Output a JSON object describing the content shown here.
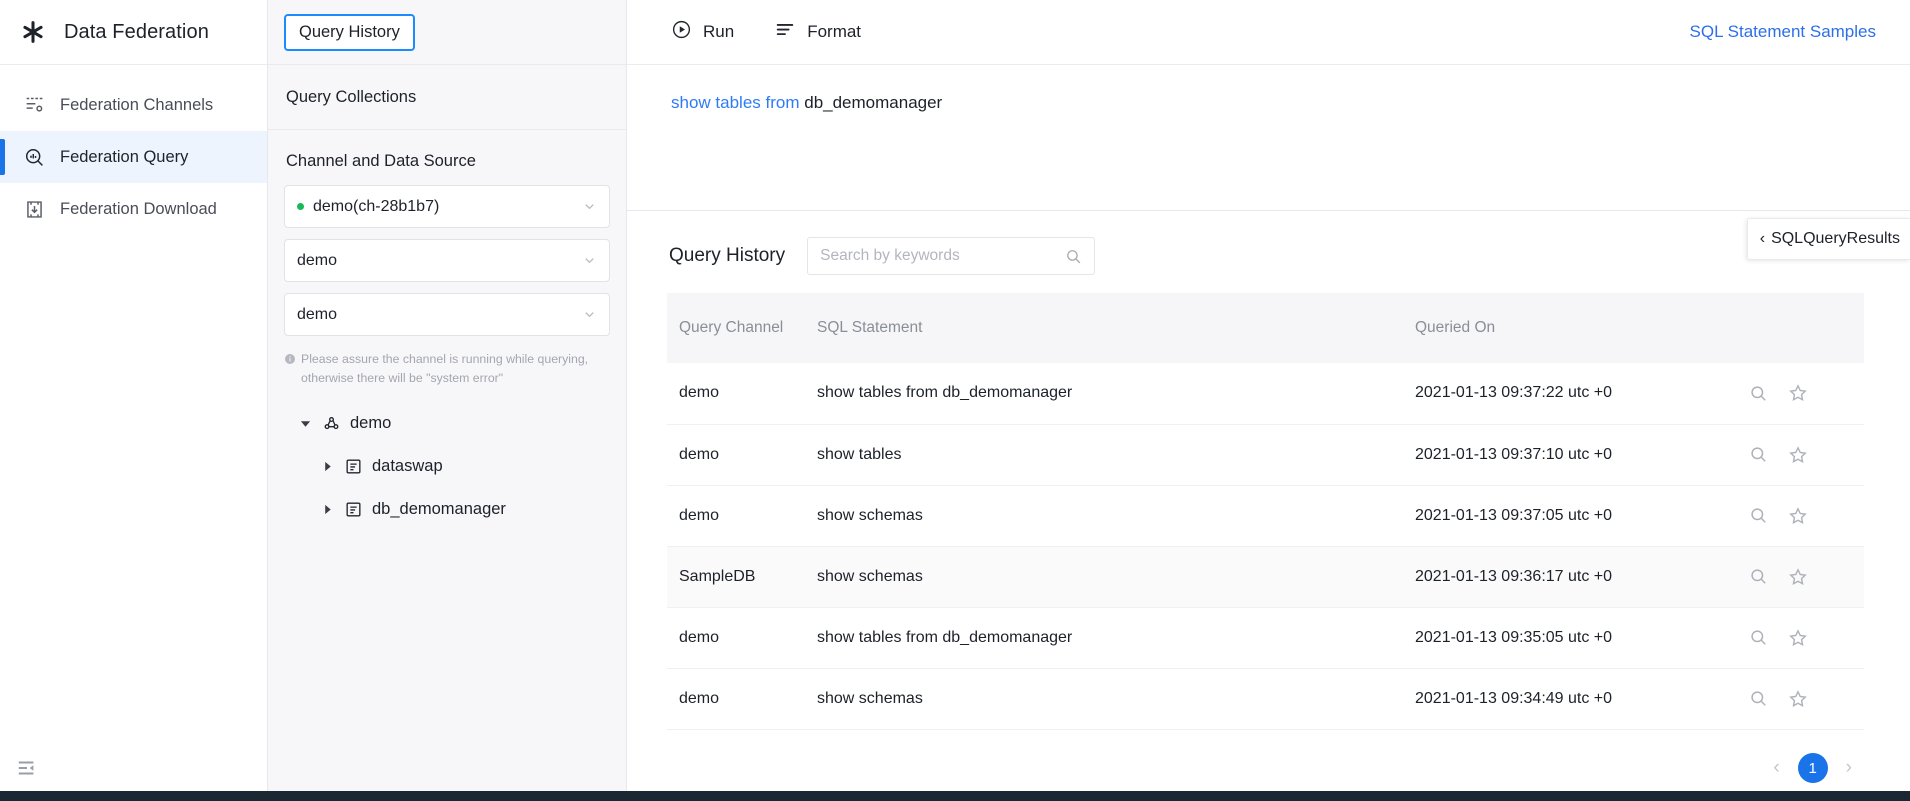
{
  "brand": {
    "title": "Data Federation",
    "logo_icon": "asterisk-logo-icon"
  },
  "sidebar": {
    "items": [
      {
        "label": "Federation Channels",
        "icon": "channels-icon",
        "active": false
      },
      {
        "label": "Federation Query",
        "icon": "query-search-icon",
        "active": true
      },
      {
        "label": "Federation Download",
        "icon": "download-box-icon",
        "active": false
      }
    ],
    "collapse_icon": "collapse-panel-icon"
  },
  "panel": {
    "tabs": [
      {
        "label": "Query History",
        "focused": true
      },
      {
        "label": "Query Collections",
        "focused": false
      }
    ],
    "section_title": "Channel and Data Source",
    "selects": [
      {
        "value": "demo(ch-28b1b7)",
        "status_dot": true,
        "dot_color": "#19b955"
      },
      {
        "value": "demo",
        "status_dot": false
      },
      {
        "value": "demo",
        "status_dot": false
      }
    ],
    "hint": "Please assure the channel is running while querying, otherwise there will be \"system error\"",
    "hint_icon": "info-circle-icon",
    "tree": [
      {
        "label": "demo",
        "icon": "catalog-icon",
        "expanded": true,
        "level": 0
      },
      {
        "label": "dataswap",
        "icon": "schema-icon",
        "expanded": false,
        "level": 1
      },
      {
        "label": "db_demomanager",
        "icon": "schema-icon",
        "expanded": false,
        "level": 1
      }
    ]
  },
  "toolbar": {
    "run_label": "Run",
    "run_icon": "play-circle-icon",
    "format_label": "Format",
    "format_icon": "format-lines-icon",
    "samples_link": "SQL Statement Samples"
  },
  "editor": {
    "keyword_part": "show tables from",
    "rest_part": "db_demomanager"
  },
  "results": {
    "title": "Query History",
    "search_placeholder": "Search by keywords",
    "search_value": "",
    "search_icon": "search-icon",
    "columns": [
      "Query Channel",
      "SQL Statement",
      "Queried On",
      ""
    ],
    "rows": [
      {
        "channel": "demo",
        "sql": "show tables from db_demomanager",
        "queried_on": "2021-01-13 09:37:22 utc +0"
      },
      {
        "channel": "demo",
        "sql": "show tables",
        "queried_on": "2021-01-13 09:37:10 utc +0"
      },
      {
        "channel": "demo",
        "sql": "show schemas",
        "queried_on": "2021-01-13 09:37:05 utc +0"
      },
      {
        "channel": "SampleDB",
        "sql": "show schemas",
        "queried_on": "2021-01-13 09:36:17 utc +0"
      },
      {
        "channel": "demo",
        "sql": "show tables from db_demomanager",
        "queried_on": "2021-01-13 09:35:05 utc +0"
      },
      {
        "channel": "demo",
        "sql": "show schemas",
        "queried_on": "2021-01-13 09:34:49 utc +0"
      }
    ],
    "row_action_icons": [
      "magnifier-icon",
      "star-icon"
    ],
    "pagination": {
      "prev": "‹",
      "current_page": "1",
      "next": "›"
    }
  },
  "side_tab": {
    "label": "SQLQueryResults",
    "chevron": "‹"
  },
  "colors": {
    "accent": "#1a73e8",
    "link": "#2d6fe8",
    "keyword": "#2f7bf6",
    "status_ok": "#19b955"
  }
}
